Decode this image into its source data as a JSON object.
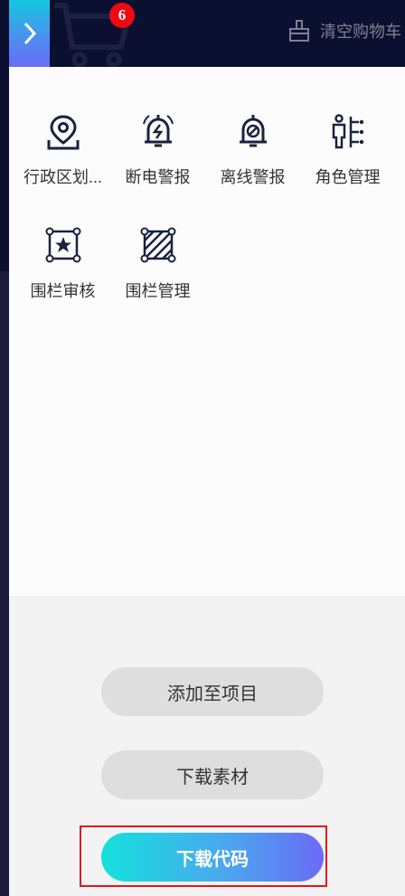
{
  "header": {
    "cart_badge": "6",
    "clear_cart_label": "清空购物车"
  },
  "icons_grid": {
    "items": [
      {
        "label": "行政区划...",
        "icon": "map-pin-icon"
      },
      {
        "label": "断电警报",
        "icon": "bell-power-icon"
      },
      {
        "label": "离线警报",
        "icon": "bell-offline-icon"
      },
      {
        "label": "角色管理",
        "icon": "role-icon"
      },
      {
        "label": "围栏审核",
        "icon": "fence-audit-icon"
      },
      {
        "label": "围栏管理",
        "icon": "fence-manage-icon"
      }
    ]
  },
  "actions": {
    "add_to_project": "添加至项目",
    "download_assets": "下载素材",
    "download_code": "下载代码"
  },
  "colors": {
    "topbar": "#0c1030",
    "badge": "#ee0a12",
    "primary_gradient_start": "#15e0dc",
    "primary_gradient_end": "#6a6bf7",
    "highlight_border": "#e0151f"
  }
}
